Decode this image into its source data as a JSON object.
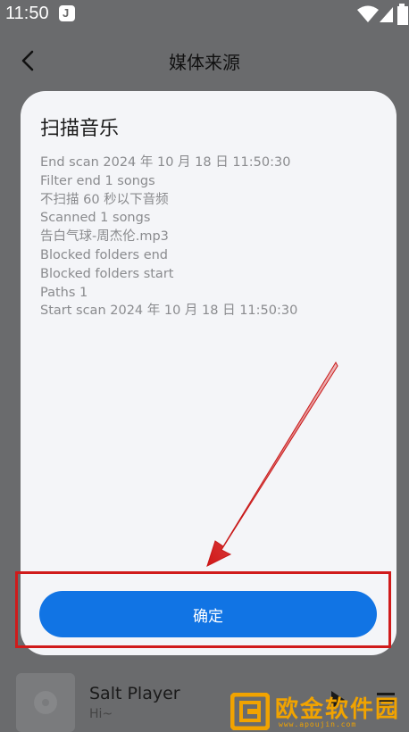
{
  "status_bar": {
    "time": "11:50",
    "app_icon": "J"
  },
  "header": {
    "title": "媒体来源"
  },
  "dialog": {
    "title": "扫描音乐",
    "log_lines": [
      "End scan 2024 年 10 月 18 日 11:50:30",
      "Filter end 1 songs",
      "不扫描 60 秒以下音频",
      "Scanned 1 songs",
      "告白气球-周杰伦.mp3",
      "Blocked folders end",
      "Blocked folders start",
      "Paths 1",
      "Start scan 2024 年 10 月 18 日 11:50:30"
    ],
    "confirm_label": "确定"
  },
  "mini_player": {
    "title": "Salt Player",
    "subtitle": "Hi~"
  },
  "watermark": {
    "text": "欧金软件园",
    "url": "www.apoujin.com"
  },
  "colors": {
    "accent": "#1174e4",
    "annotation": "#d01b1b",
    "watermark": "#f1a300"
  }
}
